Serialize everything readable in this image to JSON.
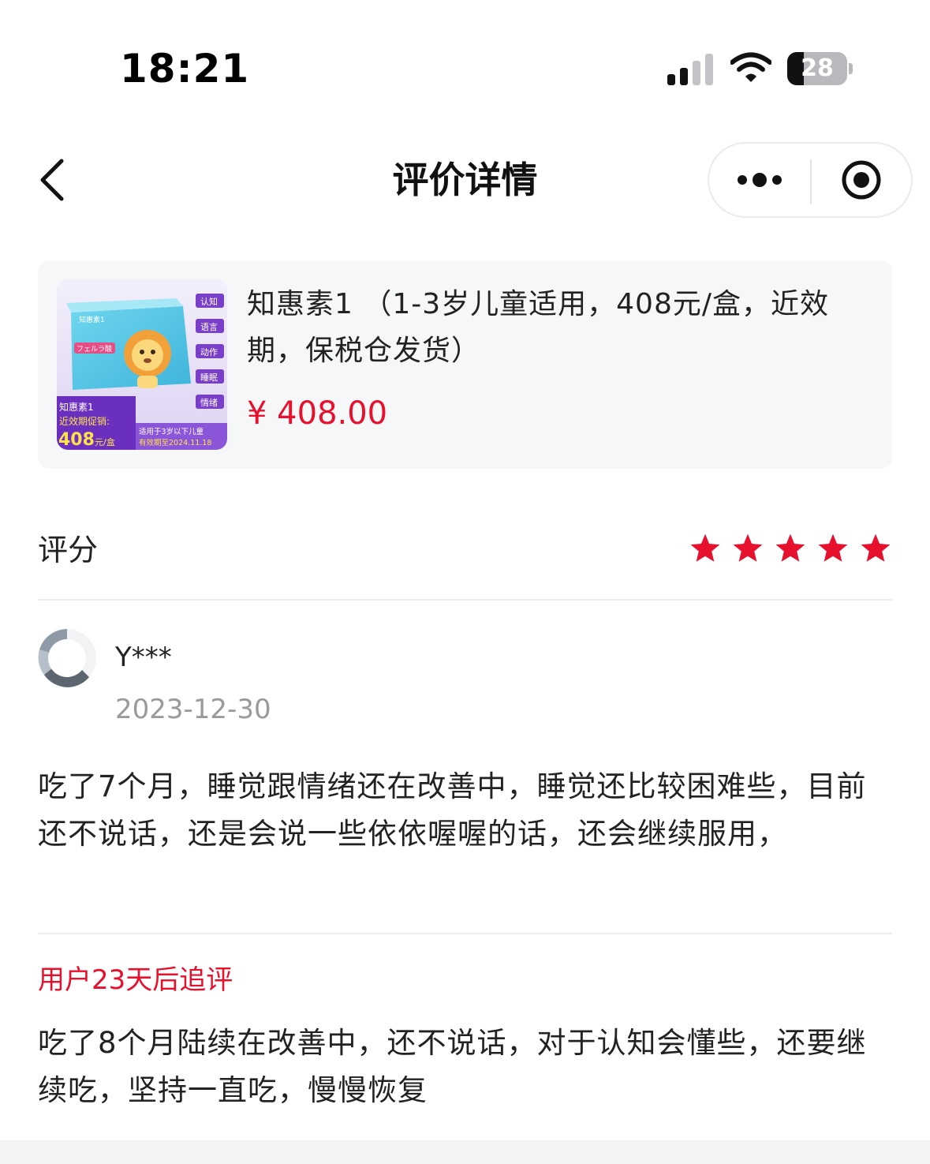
{
  "status_bar": {
    "time": "18:21",
    "battery_level": "28",
    "battery_fraction": 0.28,
    "icons": [
      "signal-icon",
      "wifi-icon",
      "battery-icon"
    ]
  },
  "nav": {
    "title": "评价详情",
    "icons": [
      "back-chevron-icon",
      "more-dots-icon",
      "close-target-icon"
    ]
  },
  "product": {
    "name": "知惠素1 （1-3岁儿童适用，408元/盒，近效期，保税仓发货）",
    "price": "¥ 408.00",
    "image": {
      "brand_text": "知惠素1",
      "box_label": "フェルラ酸",
      "side_tags": [
        "认知",
        "语言",
        "动作",
        "睡眠",
        "情绪"
      ],
      "promo_title": "知惠素1",
      "promo_line": "近效期促销:",
      "promo_price": "408",
      "promo_unit": "元/盒",
      "usage_line": "适用于3岁以下儿童",
      "expiry_line": "有效期至2024.11.18"
    }
  },
  "rating": {
    "label": "评分",
    "stars": 5,
    "max_stars": 5,
    "star_color": "#e8112d"
  },
  "review": {
    "user_name": "Y***",
    "date": "2023-12-30",
    "content": "吃了7个月，睡觉跟情绪还在改善中，睡觉还比较困难些，目前还不说话，还是会说一些依依喔喔的话，还会继续服用，"
  },
  "followup": {
    "title": "用户23天后追评",
    "content": "吃了8个月陆续在改善中，还不说话，对于认知会懂些，还要继续吃，坚持一直吃，慢慢恢复"
  },
  "colors": {
    "accent_red": "#e8112d",
    "card_bg": "#f6f7f9",
    "muted_text": "#9a9a9a"
  }
}
